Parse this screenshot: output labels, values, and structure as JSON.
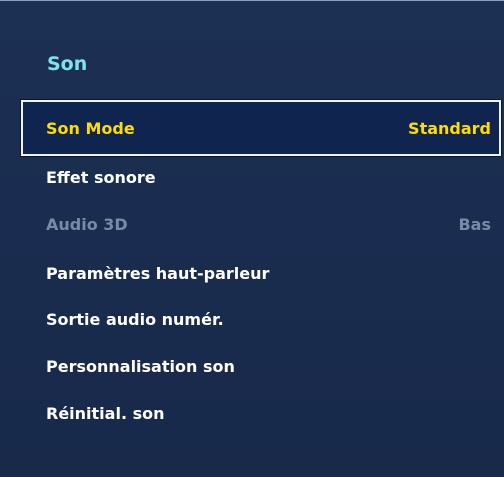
{
  "menu": {
    "title": "Son",
    "items": [
      {
        "label": "Son Mode",
        "value": "Standard"
      },
      {
        "label": "Effet sonore",
        "value": ""
      },
      {
        "label": "Audio 3D",
        "value": "Bas"
      },
      {
        "label": "Paramètres haut-parleur",
        "value": ""
      },
      {
        "label": "Sortie audio numér.",
        "value": ""
      },
      {
        "label": "Personnalisation son",
        "value": ""
      },
      {
        "label": "Réinitial. son",
        "value": ""
      }
    ],
    "selected_index": 0,
    "disabled_index": 2
  },
  "colors": {
    "background": "#1a2e4f",
    "title": "#7fe3ec",
    "selected_text": "#ffdd00",
    "disabled_text": "#7a8aa6"
  }
}
